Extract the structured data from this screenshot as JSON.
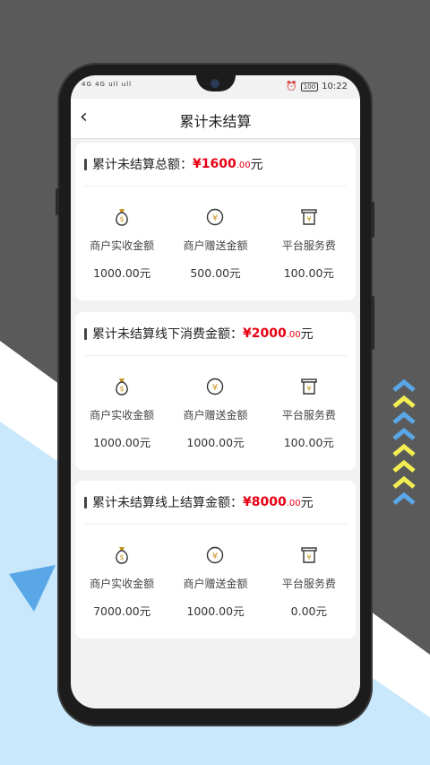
{
  "nav": {
    "back_label": "‹",
    "title": "累计未结算"
  },
  "status": {
    "left": "4G 4G ull ull",
    "time": "10:22",
    "battery": "100"
  },
  "cards": [
    {
      "label": "累计未结算总额：",
      "amount_main": "¥1600",
      "amount_dec": ".00",
      "unit": "元",
      "items": [
        {
          "label": "商户实收金额",
          "value": "1000.00元"
        },
        {
          "label": "商户赠送金额",
          "value": "500.00元"
        },
        {
          "label": "平台服务费",
          "value": "100.00元"
        }
      ]
    },
    {
      "label": "累计未结算线下消费金额：",
      "amount_main": "¥2000",
      "amount_dec": ".00",
      "unit": "元",
      "items": [
        {
          "label": "商户实收金额",
          "value": "1000.00元"
        },
        {
          "label": "商户赠送金额",
          "value": "1000.00元"
        },
        {
          "label": "平台服务费",
          "value": "100.00元"
        }
      ]
    },
    {
      "label": "累计未结算线上结算金额：",
      "amount_main": "¥8000",
      "amount_dec": ".00",
      "unit": "元",
      "items": [
        {
          "label": "商户实收金额",
          "value": "7000.00元"
        },
        {
          "label": "商户赠送金额",
          "value": "1000.00元"
        },
        {
          "label": "平台服务费",
          "value": "0.00元"
        }
      ]
    }
  ],
  "colors": {
    "amount": "#e60012",
    "bg_dark": "#5a5a5a",
    "bg_light": "#c9e8fb",
    "chevron_blue": "#5aa7e8",
    "chevron_yellow": "#f2ee52"
  }
}
